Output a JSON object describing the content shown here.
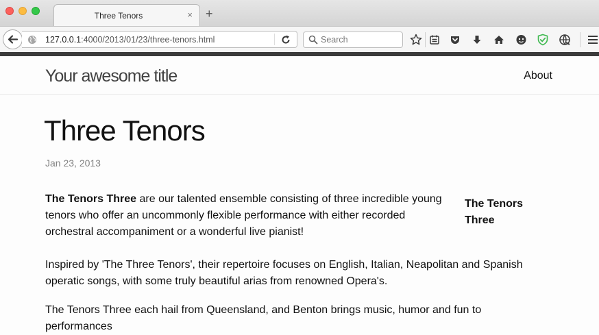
{
  "browser": {
    "tab_title": "Three Tenors",
    "tab_close": "×",
    "new_tab": "+",
    "url_host": "127.0.0.1",
    "url_rest": ":4000/2013/01/23/three-tenors.html",
    "search_placeholder": "Search"
  },
  "site": {
    "title": "Your awesome title",
    "nav": {
      "about": "About"
    }
  },
  "post": {
    "title": "Three Tenors",
    "date": "Jan 23, 2013",
    "p1_bold": "The Tenors Three",
    "p1_text": " are our talented ensemble consisting of three incredible young tenors who offer an uncommonly flexible performance with either recorded orchestral accompaniment or a wonderful live pianist!",
    "p2": "Inspired by 'The Three Tenors', their repertoire focuses on English, Italian, Neapolitan and Spanish operatic songs, with some truly beautiful arias from renowned Opera's.",
    "p3": "The Tenors Three each hail from Queensland, and Benton brings music, humor and fun to performances",
    "aside": "The Tenors Three"
  },
  "colors": {
    "shield": "#3fb950",
    "text": "#111111",
    "date": "#828282"
  }
}
